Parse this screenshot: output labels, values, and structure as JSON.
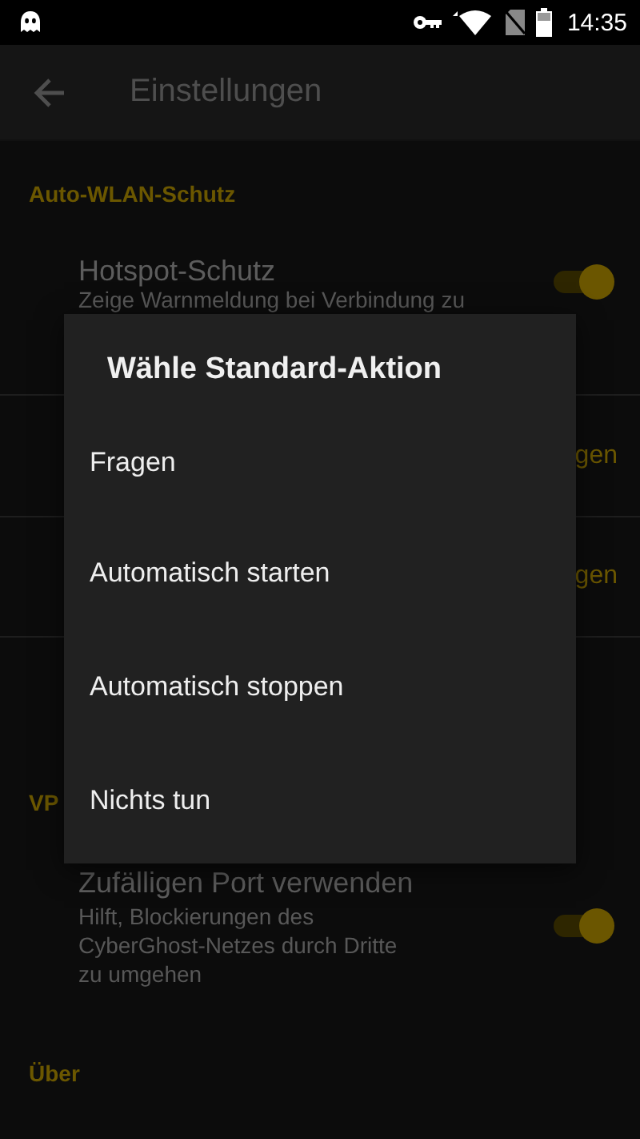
{
  "status_bar": {
    "time": "14:35"
  },
  "app_bar": {
    "title": "Einstellungen"
  },
  "settings": [
    {
      "kind": "header",
      "label": "Auto-WLAN-Schutz"
    },
    {
      "kind": "switch",
      "title": "Hotspot-Schutz",
      "subtitle": "Zeige Warnmeldung bei Verbindung zu",
      "on": true
    },
    {
      "kind": "value",
      "value": "gen"
    },
    {
      "kind": "value",
      "value": "gen"
    },
    {
      "kind": "header",
      "label": "VP"
    },
    {
      "kind": "switch",
      "title": "Zufälligen Port verwenden",
      "subtitle": "Hilft, Blockierungen des CyberGhost-Netzes durch Dritte zu umgehen",
      "on": true
    },
    {
      "kind": "header",
      "label": "Über"
    }
  ],
  "dialog": {
    "title": "Wähle Standard-Aktion",
    "options": [
      "Fragen",
      "Automatisch starten",
      "Automatisch stoppen",
      "Nichts tun"
    ]
  }
}
